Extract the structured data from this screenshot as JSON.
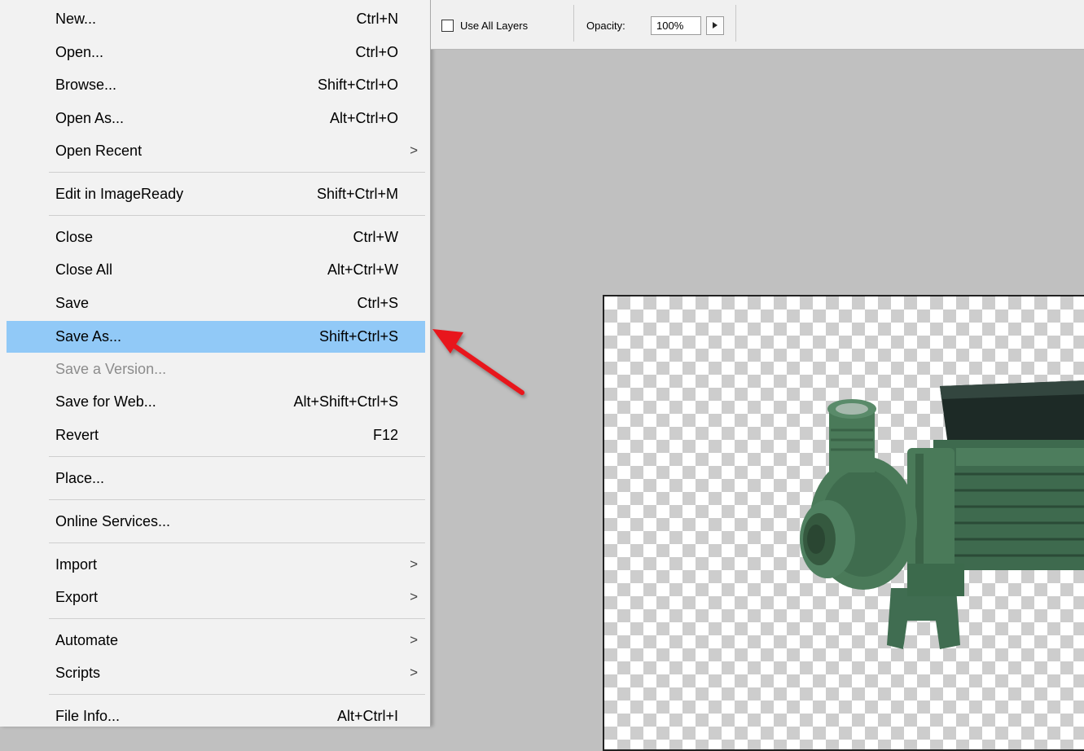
{
  "menu": {
    "items": [
      {
        "label": "New...",
        "shortcut": "Ctrl+N"
      },
      {
        "label": "Open...",
        "shortcut": "Ctrl+O"
      },
      {
        "label": "Browse...",
        "shortcut": "Shift+Ctrl+O"
      },
      {
        "label": "Open As...",
        "shortcut": "Alt+Ctrl+O"
      },
      {
        "label": "Open Recent",
        "submenu_arrow": ">"
      },
      {
        "label": "Edit in ImageReady",
        "shortcut": "Shift+Ctrl+M"
      },
      {
        "label": "Close",
        "shortcut": "Ctrl+W"
      },
      {
        "label": "Close All",
        "shortcut": "Alt+Ctrl+W"
      },
      {
        "label": "Save",
        "shortcut": "Ctrl+S"
      },
      {
        "label": "Save As...",
        "shortcut": "Shift+Ctrl+S",
        "state": "highlighted"
      },
      {
        "label": "Save a Version...",
        "state": "disabled"
      },
      {
        "label": "Save for Web...",
        "shortcut": "Alt+Shift+Ctrl+S"
      },
      {
        "label": "Revert",
        "shortcut": "F12"
      },
      {
        "label": "Place..."
      },
      {
        "label": "Online Services..."
      },
      {
        "label": "Import",
        "submenu_arrow": ">"
      },
      {
        "label": "Export",
        "submenu_arrow": ">"
      },
      {
        "label": "Automate",
        "submenu_arrow": ">"
      },
      {
        "label": "Scripts",
        "submenu_arrow": ">"
      },
      {
        "label": "File Info...",
        "shortcut": "Alt+Ctrl+I"
      }
    ],
    "highlight_color": "#91c9f7"
  },
  "options_bar": {
    "use_all_layers_label": "Use All Layers",
    "use_all_layers_checked": false,
    "opacity_label": "Opacity:",
    "opacity_value": "100%"
  },
  "canvas": {
    "background_color": "#c0c0c0",
    "transparency_pattern": "checkerboard",
    "image_subject": "green-water-pump"
  },
  "annotation": {
    "arrow_color": "#e8141a",
    "points_to": "Save As..."
  }
}
